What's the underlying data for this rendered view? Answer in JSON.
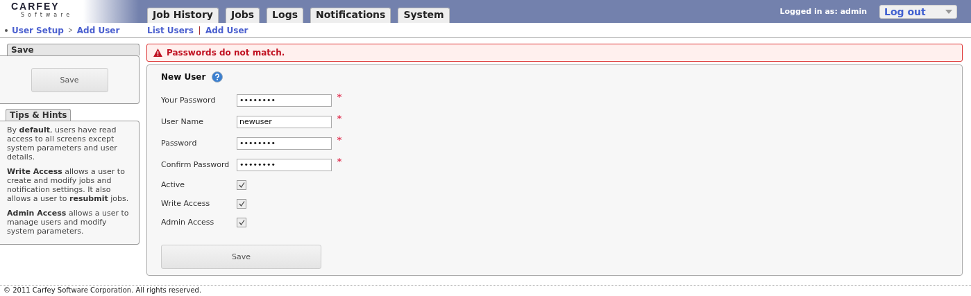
{
  "logo": {
    "name": "CARFEY",
    "sub": "Software"
  },
  "tabs": [
    {
      "label": "Job History",
      "selected": false
    },
    {
      "label": "Jobs",
      "selected": false
    },
    {
      "label": "Logs",
      "selected": false
    },
    {
      "label": "Notifications",
      "selected": false
    },
    {
      "label": "System",
      "selected": false
    }
  ],
  "user": {
    "logged_in": "Logged in as: admin",
    "menu": "Log out"
  },
  "breadcrumb": [
    "User Setup",
    "Add User"
  ],
  "subnav": [
    "List Users",
    "Add User"
  ],
  "sidebar": {
    "save_panel": {
      "title": "Save",
      "button": "Save"
    },
    "tips_panel": {
      "title": "Tips & Hints",
      "paragraphs": [
        "By **default**, users have read access to all screens except system parameters and user details.",
        "**Write Access** allows a user to create and modify jobs and notification settings. It also allows a user to **resubmit** jobs.",
        "**Admin Access** allows a user to manage users and modify system parameters."
      ]
    }
  },
  "error": "Passwords do not match.",
  "form": {
    "title": "New User",
    "fields": [
      {
        "label": "Your Password",
        "value": "••••••••",
        "required": true
      },
      {
        "label": "User Name",
        "value": "newuser",
        "required": true
      },
      {
        "label": "Password",
        "value": "••••••••",
        "required": true
      },
      {
        "label": "Confirm Password",
        "value": "••••••••",
        "required": true
      }
    ],
    "checkboxes": [
      {
        "label": "Active",
        "checked": true
      },
      {
        "label": "Write Access",
        "checked": true
      },
      {
        "label": "Admin Access",
        "checked": true
      }
    ],
    "button": "Save"
  },
  "footer": "© 2011 Carfey Software Corporation. All rights reserved."
}
